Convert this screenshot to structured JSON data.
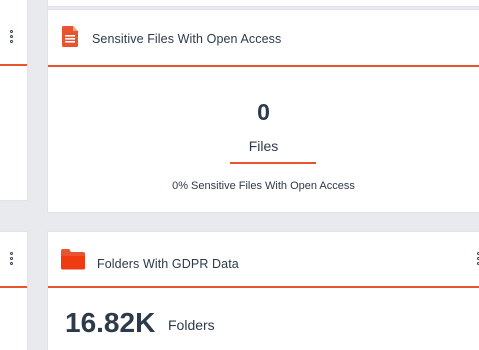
{
  "sensitive_card": {
    "title": "Sensitive Files With Open Access",
    "value": "0",
    "unit": "Files",
    "subtitle": "0% Sensitive Files With Open Access",
    "icon": "document-icon",
    "accent": "#e8542f"
  },
  "gdpr_card": {
    "title": "Folders With GDPR Data",
    "value": "16.82K",
    "unit": "Folders",
    "icon": "folder-icon",
    "accent": "#e8542f"
  }
}
